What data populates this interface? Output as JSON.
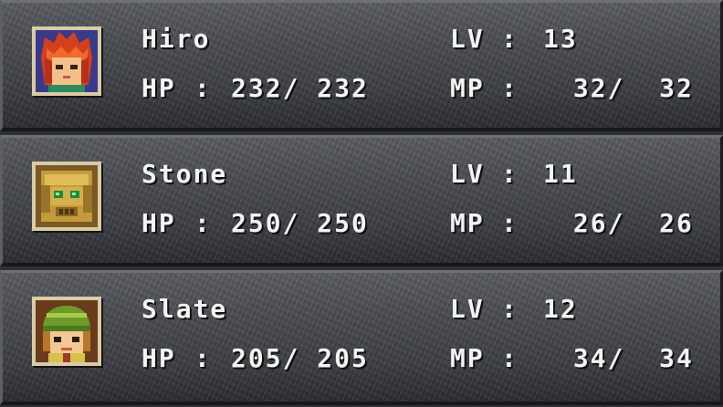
{
  "labels": {
    "hp": "HP",
    "mp": "MP",
    "lv": "LV",
    "colon": ":"
  },
  "party": [
    {
      "name": "Hiro",
      "level": "13",
      "hp": "232/ 232",
      "mp": " 32/  32",
      "portrait_icon": "red-haired-hero-portrait-icon"
    },
    {
      "name": "Stone",
      "level": "11",
      "hp": "250/ 250",
      "mp": " 26/  26",
      "portrait_icon": "golden-robot-portrait-icon"
    },
    {
      "name": "Slate",
      "level": "12",
      "hp": "205/ 205",
      "mp": " 34/  34",
      "portrait_icon": "green-helmet-girl-portrait-icon"
    }
  ],
  "colors": {
    "text": "#f3f3f3",
    "frame": "#d9cba6",
    "panel": "#4a4d52"
  }
}
